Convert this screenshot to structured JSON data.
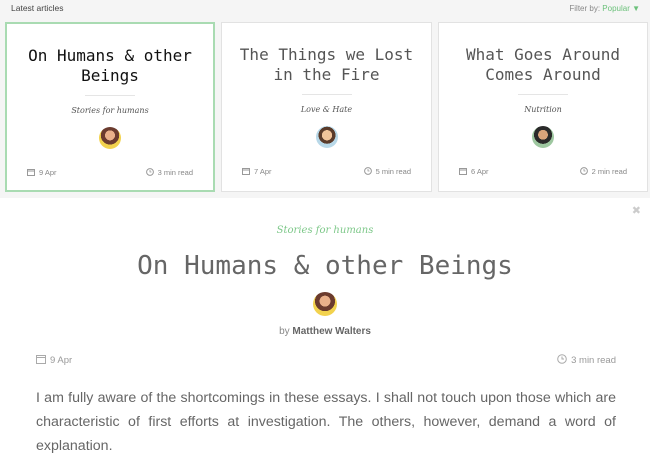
{
  "header": {
    "section_title": "Latest articles",
    "filter_label": "Filter by:",
    "filter_value": "Popular ▼"
  },
  "cards": [
    {
      "title": "On Humans & other Beings",
      "tag": "Stories for humans",
      "date": "9 Apr",
      "read_time": "3 min read",
      "active": true
    },
    {
      "title": "The Things we Lost in the Fire",
      "tag": "Love & Hate",
      "date": "7 Apr",
      "read_time": "5 min read",
      "active": false
    },
    {
      "title": "What Goes Around Comes Around",
      "tag": "Nutrition",
      "date": "6 Apr",
      "read_time": "2 min read",
      "active": false
    }
  ],
  "article": {
    "close_symbol": "✖",
    "tag": "Stories for humans",
    "title": "On Humans & other Beings",
    "by": "by",
    "author": "Matthew Walters",
    "date": "9 Apr",
    "read_time": "3 min read",
    "body": "I am fully aware of the shortcomings in these essays. I shall not touch upon those which are characteristic of first efforts at investigation. The others, however, demand a word of explanation."
  },
  "colors": {
    "accent": "#6cc17b",
    "active_border": "#a9dbb2",
    "page_bg": "#f5f5f5"
  }
}
